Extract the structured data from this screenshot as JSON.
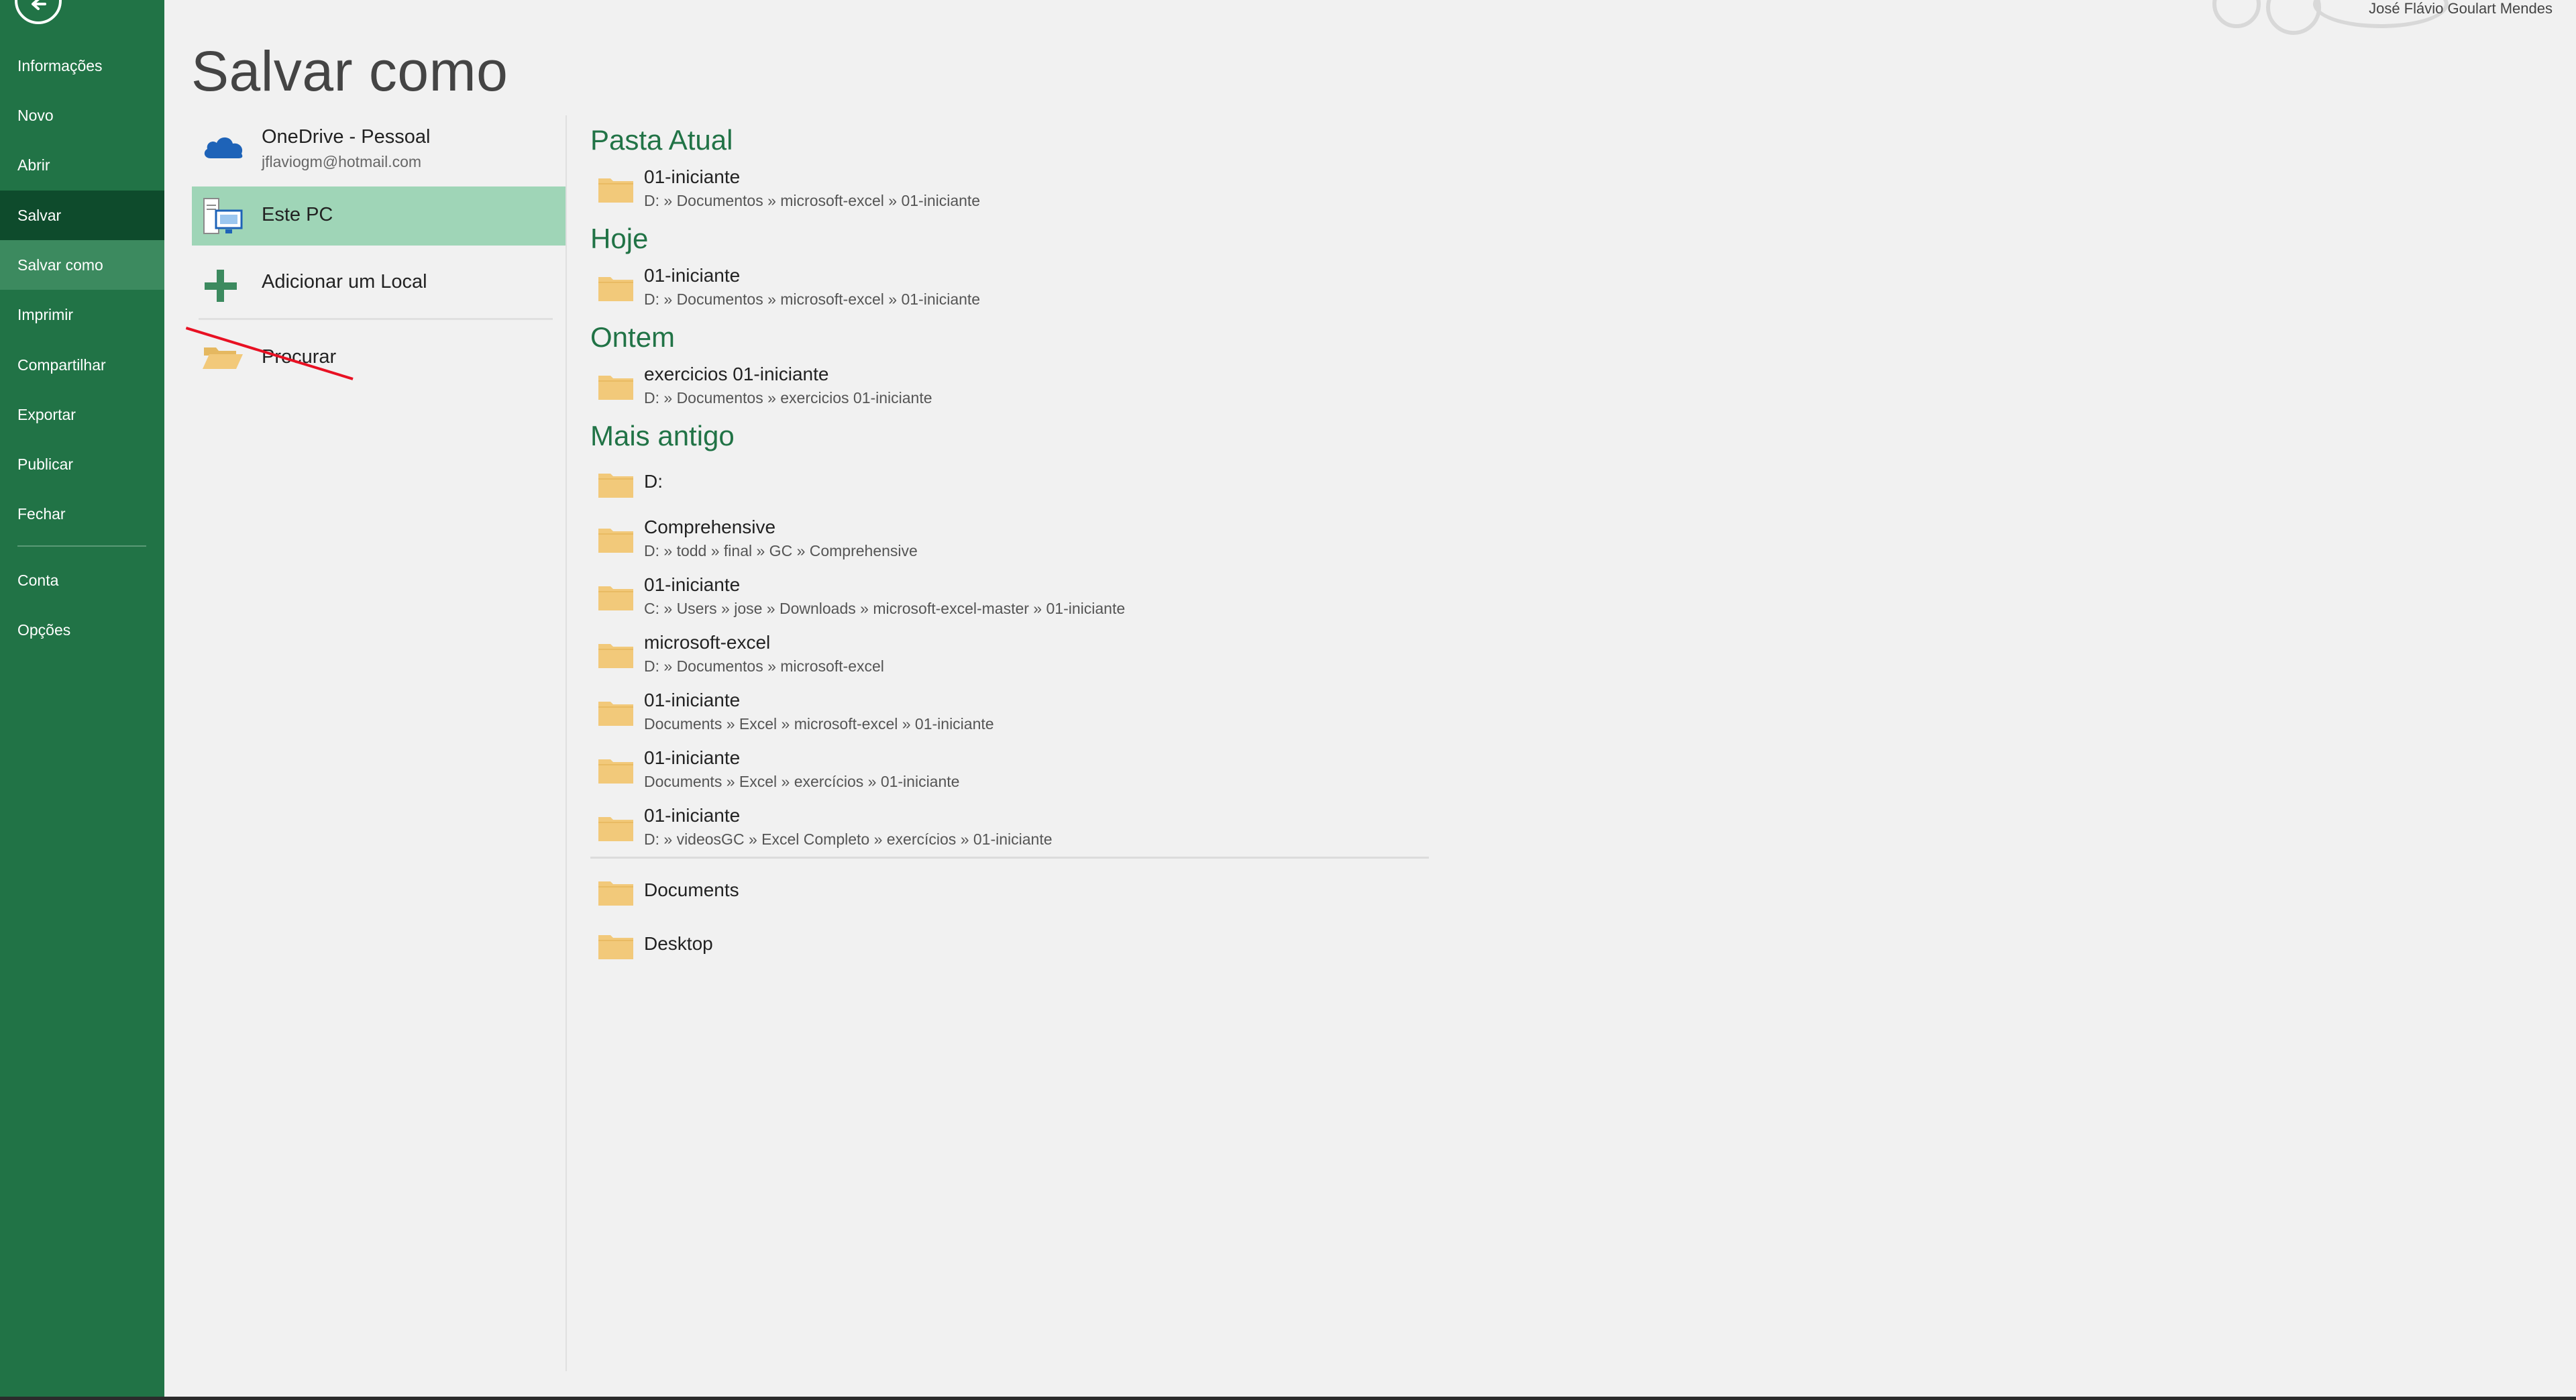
{
  "user": {
    "name": "José Flávio Goulart Mendes"
  },
  "nav": {
    "items": [
      {
        "label": "Informações"
      },
      {
        "label": "Novo"
      },
      {
        "label": "Abrir"
      },
      {
        "label": "Salvar"
      },
      {
        "label": "Salvar como"
      },
      {
        "label": "Imprimir"
      },
      {
        "label": "Compartilhar"
      },
      {
        "label": "Exportar"
      },
      {
        "label": "Publicar"
      },
      {
        "label": "Fechar"
      },
      {
        "label": "Conta"
      },
      {
        "label": "Opções"
      }
    ]
  },
  "page": {
    "title": "Salvar como"
  },
  "locations": {
    "onedrive": {
      "title": "OneDrive - Pessoal",
      "subtitle": "jflaviogm@hotmail.com",
      "icon": "cloud-icon"
    },
    "this_pc": {
      "title": "Este PC",
      "icon": "computer-icon"
    },
    "add_place": {
      "title": "Adicionar um Local",
      "icon": "plus-icon"
    },
    "browse": {
      "title": "Procurar",
      "icon": "open-folder-icon"
    }
  },
  "groups": {
    "current": {
      "heading": "Pasta Atual",
      "folders": [
        {
          "name": "01-iniciante",
          "path": "D: » Documentos » microsoft-excel » 01-iniciante"
        }
      ]
    },
    "today": {
      "heading": "Hoje",
      "folders": [
        {
          "name": "01-iniciante",
          "path": "D: » Documentos » microsoft-excel » 01-iniciante"
        }
      ]
    },
    "yesterday": {
      "heading": "Ontem",
      "folders": [
        {
          "name": "exercicios 01-iniciante",
          "path": "D: » Documentos » exercicios 01-iniciante"
        }
      ]
    },
    "older": {
      "heading": "Mais antigo",
      "folders": [
        {
          "name": "D:",
          "path": ""
        },
        {
          "name": "Comprehensive",
          "path": "D: » todd » final » GC » Comprehensive"
        },
        {
          "name": "01-iniciante",
          "path": "C: » Users » jose » Downloads » microsoft-excel-master » 01-iniciante"
        },
        {
          "name": "microsoft-excel",
          "path": "D: » Documentos » microsoft-excel"
        },
        {
          "name": "01-iniciante",
          "path": "Documents » Excel » microsoft-excel » 01-iniciante"
        },
        {
          "name": "01-iniciante",
          "path": "Documents » Excel » exercícios » 01-iniciante"
        },
        {
          "name": "01-iniciante",
          "path": "D: » videosGC » Excel Completo » exercícios » 01-iniciante"
        }
      ]
    },
    "pinned": {
      "folders": [
        {
          "name": "Documents"
        },
        {
          "name": "Desktop"
        }
      ]
    }
  },
  "colors": {
    "nav_bg": "#217346",
    "nav_active": "#0e4b2c",
    "nav_selected": "#3c8a5f",
    "heading_green": "#217346",
    "location_selected": "#9fd5b7",
    "folder_yellow": "#f2c97a"
  }
}
